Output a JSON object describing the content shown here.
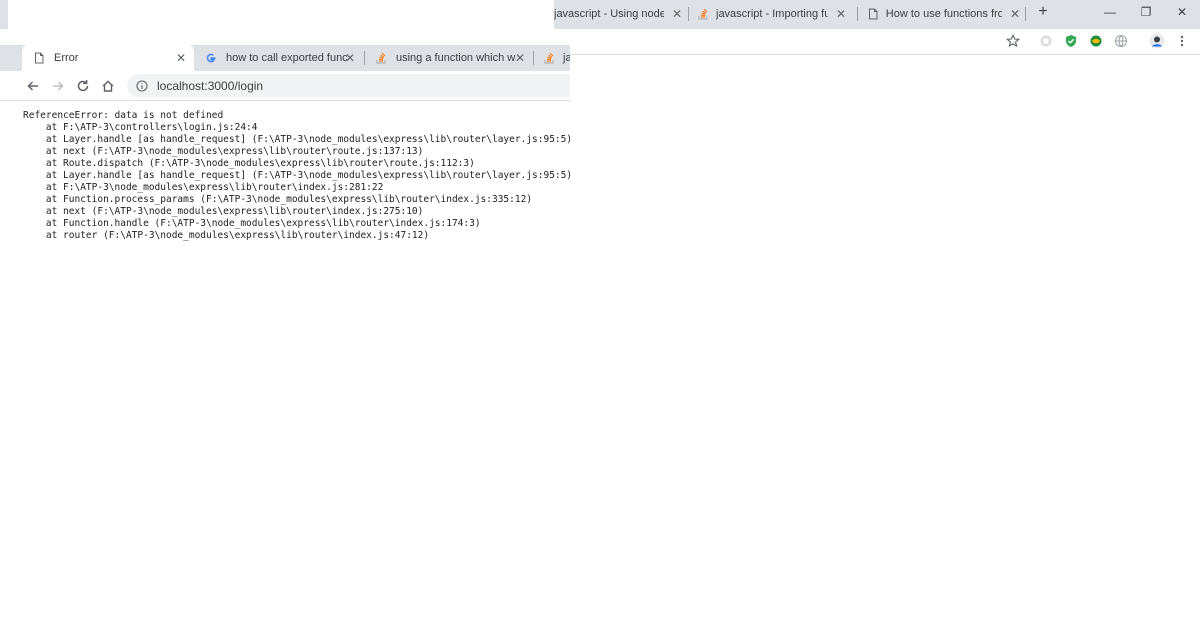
{
  "background_window": {
    "tabs": [
      {
        "label": "javascript - Using node mod",
        "favicon": "page-icon"
      },
      {
        "label": "javascript - Importing functic",
        "favicon": "stackoverflow-icon"
      },
      {
        "label": "How to use functions from a",
        "favicon": "page-icon"
      }
    ],
    "new_tab_label": "+",
    "window_controls": {
      "minimize": "—",
      "restore": "❐",
      "close": "✕"
    }
  },
  "foreground_window": {
    "tabs": [
      {
        "label": "Error",
        "favicon": "page-icon",
        "active": true
      },
      {
        "label": "how to call exported function",
        "favicon": "google-icon"
      },
      {
        "label": "using a function which was in",
        "favicon": "stackoverflow-icon"
      },
      {
        "label": "jav",
        "favicon": "stackoverflow-icon"
      }
    ],
    "address": {
      "url": "localhost:3000/login"
    }
  },
  "error_page": {
    "message": "ReferenceError: data is not defined",
    "stack": [
      "    at F:\\ATP-3\\controllers\\login.js:24:4",
      "    at Layer.handle [as handle_request] (F:\\ATP-3\\node_modules\\express\\lib\\router\\layer.js:95:5)",
      "    at next (F:\\ATP-3\\node_modules\\express\\lib\\router\\route.js:137:13)",
      "    at Route.dispatch (F:\\ATP-3\\node_modules\\express\\lib\\router\\route.js:112:3)",
      "    at Layer.handle [as handle_request] (F:\\ATP-3\\node_modules\\express\\lib\\router\\layer.js:95:5)",
      "    at F:\\ATP-3\\node_modules\\express\\lib\\router\\index.js:281:22",
      "    at Function.process_params (F:\\ATP-3\\node_modules\\express\\lib\\router\\index.js:335:12)",
      "    at next (F:\\ATP-3\\node_modules\\express\\lib\\router\\index.js:275:10)",
      "    at Function.handle (F:\\ATP-3\\node_modules\\express\\lib\\router\\index.js:174:3)",
      "    at router (F:\\ATP-3\\node_modules\\express\\lib\\router\\index.js:47:12)"
    ]
  },
  "colors": {
    "tabstrip": "#dee1e6",
    "omnibox": "#f1f3f4",
    "text": "#3c4043",
    "stackoverflow": "#f48024"
  }
}
